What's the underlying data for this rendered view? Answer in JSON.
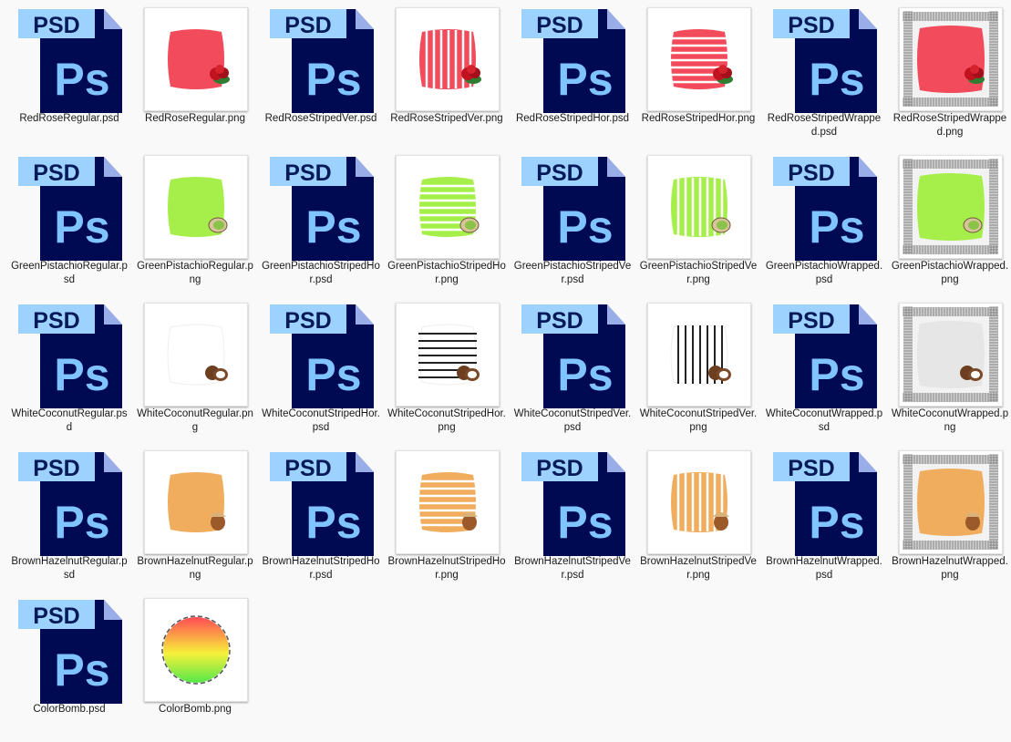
{
  "colors": {
    "rose": "#f24b5b",
    "pistachio": "#a6ef4a",
    "coconut": "#ffffff",
    "hazelnut": "#f0ad5e",
    "psd_bg": "#000a52",
    "psd_text": "#7fc3ff",
    "psd_tab": "#9dd2ff"
  },
  "psd_icon": {
    "badge": "PSD",
    "logo": "Ps"
  },
  "files": [
    {
      "name": "RedRoseRegular.psd",
      "kind": "psd"
    },
    {
      "name": "RedRoseRegular.png",
      "kind": "png",
      "color": "rose",
      "style": "regular",
      "fruit": "rose"
    },
    {
      "name": "RedRoseStripedVer.psd",
      "kind": "psd"
    },
    {
      "name": "RedRoseStripedVer.png",
      "kind": "png",
      "color": "rose",
      "style": "ver",
      "fruit": "rose"
    },
    {
      "name": "RedRoseStripedHor.psd",
      "kind": "psd"
    },
    {
      "name": "RedRoseStripedHor.png",
      "kind": "png",
      "color": "rose",
      "style": "hor",
      "fruit": "rose"
    },
    {
      "name": "RedRoseStripedWrapped.psd",
      "kind": "psd"
    },
    {
      "name": "RedRoseStripedWrapped.png",
      "kind": "png",
      "color": "rose",
      "style": "wrapped",
      "fruit": "rose"
    },
    {
      "name": "GreenPistachioRegular.psd",
      "kind": "psd"
    },
    {
      "name": "GreenPistachioRegular.png",
      "kind": "png",
      "color": "pistachio",
      "style": "regular",
      "fruit": "pistachio"
    },
    {
      "name": "GreenPistachioStripedHor.psd",
      "kind": "psd"
    },
    {
      "name": "GreenPistachioStripedHor.png",
      "kind": "png",
      "color": "pistachio",
      "style": "hor",
      "fruit": "pistachio"
    },
    {
      "name": "GreenPistachioStripedVer.psd",
      "kind": "psd"
    },
    {
      "name": "GreenPistachioStripedVer.png",
      "kind": "png",
      "color": "pistachio",
      "style": "ver",
      "fruit": "pistachio"
    },
    {
      "name": "GreenPistachioWrapped.psd",
      "kind": "psd"
    },
    {
      "name": "GreenPistachioWrapped.png",
      "kind": "png",
      "color": "pistachio",
      "style": "wrapped",
      "fruit": "pistachio"
    },
    {
      "name": "WhiteCoconutRegular.psd",
      "kind": "psd"
    },
    {
      "name": "WhiteCoconutRegular.png",
      "kind": "png",
      "color": "coconut",
      "style": "regular",
      "fruit": "coconut"
    },
    {
      "name": "WhiteCoconutStripedHor.psd",
      "kind": "psd"
    },
    {
      "name": "WhiteCoconutStripedHor.png",
      "kind": "png",
      "color": "coconut",
      "style": "hor",
      "fruit": "coconut"
    },
    {
      "name": "WhiteCoconutStripedVer.psd",
      "kind": "psd"
    },
    {
      "name": "WhiteCoconutStripedVer.png",
      "kind": "png",
      "color": "coconut",
      "style": "ver",
      "fruit": "coconut"
    },
    {
      "name": "WhiteCoconutWrapped.psd",
      "kind": "psd"
    },
    {
      "name": "WhiteCoconutWrapped.png",
      "kind": "png",
      "color": "coconut",
      "style": "wrapped",
      "fruit": "coconut"
    },
    {
      "name": "BrownHazelnutRegular.psd",
      "kind": "psd"
    },
    {
      "name": "BrownHazelnutRegular.png",
      "kind": "png",
      "color": "hazelnut",
      "style": "regular",
      "fruit": "hazelnut"
    },
    {
      "name": "BrownHazelnutStripedHor.psd",
      "kind": "psd"
    },
    {
      "name": "BrownHazelnutStripedHor.png",
      "kind": "png",
      "color": "hazelnut",
      "style": "hor",
      "fruit": "hazelnut"
    },
    {
      "name": "BrownHazelnutStripedVer.psd",
      "kind": "psd"
    },
    {
      "name": "BrownHazelnutStripedVer.png",
      "kind": "png",
      "color": "hazelnut",
      "style": "ver",
      "fruit": "hazelnut"
    },
    {
      "name": "BrownHazelnutWrapped.psd",
      "kind": "psd"
    },
    {
      "name": "BrownHazelnutWrapped.png",
      "kind": "png",
      "color": "hazelnut",
      "style": "wrapped",
      "fruit": "hazelnut"
    },
    {
      "name": "ColorBomb.psd",
      "kind": "psd"
    },
    {
      "name": "ColorBomb.png",
      "kind": "png",
      "style": "bomb"
    }
  ]
}
